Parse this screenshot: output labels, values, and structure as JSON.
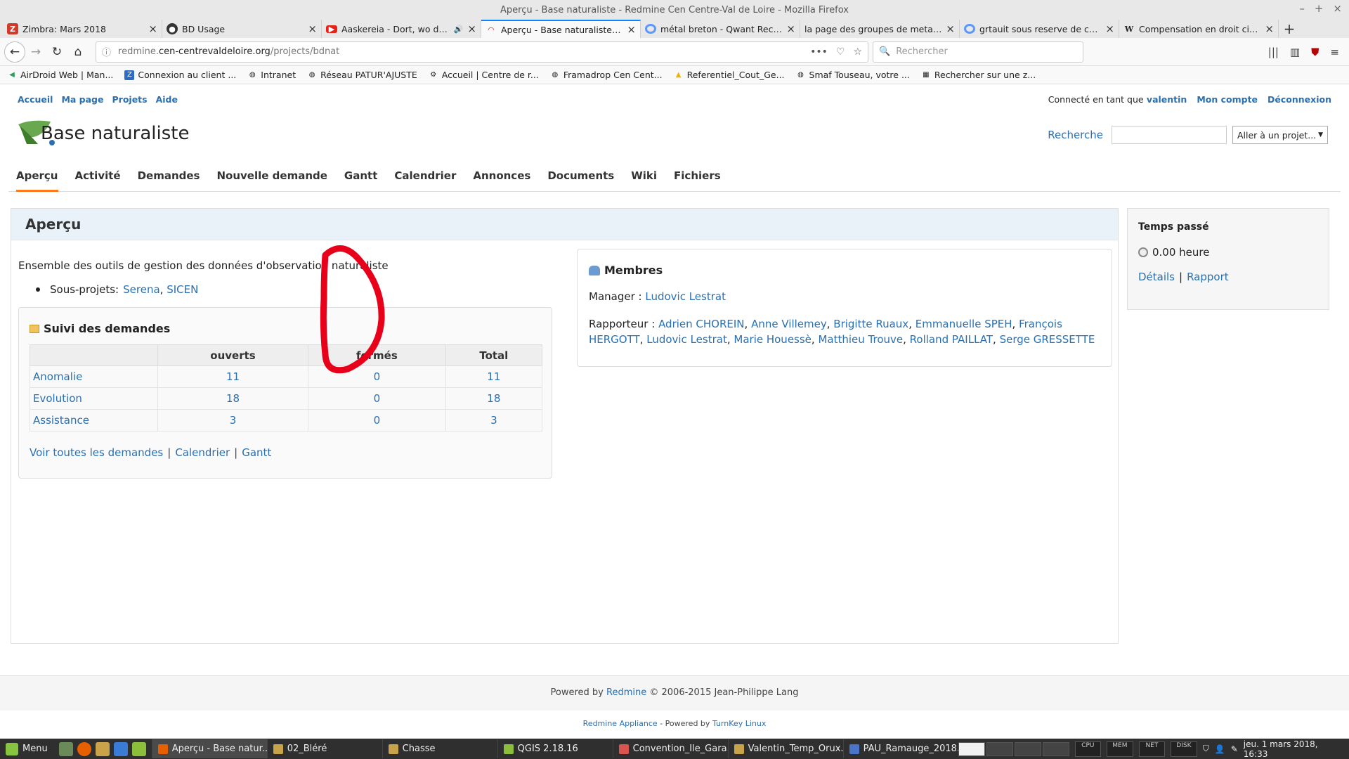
{
  "window": {
    "title": "Aperçu - Base naturaliste - Redmine Cen Centre-Val de Loire - Mozilla Firefox"
  },
  "tabs": [
    {
      "label": "Zimbra: Mars 2018",
      "icon": "zimbra-icon",
      "color": "#d03a2b"
    },
    {
      "label": "BD Usage",
      "icon": "app-icon",
      "color": "#333333"
    },
    {
      "label": "Aaskereia - Dort, wo das alt",
      "icon": "youtube-icon",
      "color": "#e62117"
    },
    {
      "label": "Aperçu - Base naturaliste - Redm",
      "icon": "redmine-icon",
      "color": "#b32024"
    },
    {
      "label": "métal breton - Qwant Recherche",
      "icon": "qwant-icon",
      "color": "#5c97ff"
    },
    {
      "label": "la page des groupes de metal bret",
      "icon": "blank-icon",
      "color": "#999999"
    },
    {
      "label": "grtauit sous reserve de comp",
      "icon": "qwant-icon",
      "color": "#5c97ff"
    },
    {
      "label": "Compensation en droit civil fr",
      "icon": "wikipedia-icon",
      "color": "#222222"
    }
  ],
  "urlbar": {
    "domain_prefix": "redmine.",
    "domain": "cen-centrevaldeloire.org",
    "path": "/projects/bdnat",
    "dots": "•••"
  },
  "searchbar": {
    "placeholder": "Rechercher"
  },
  "bookmarks": [
    {
      "label": "AirDroid Web | Man...",
      "color": "#2e9d5b"
    },
    {
      "label": "Connexion au client ...",
      "color": "#2b6cc4"
    },
    {
      "label": "Intranet",
      "color": "#666666"
    },
    {
      "label": "Réseau PATUR'AJUSTE",
      "color": "#666666"
    },
    {
      "label": "Accueil | Centre de r...",
      "color": "#666666"
    },
    {
      "label": "Framadrop Cen Cent...",
      "color": "#666666"
    },
    {
      "label": "Referentiel_Cout_Ge...",
      "color": "#f0b400"
    },
    {
      "label": "Smaf Touseau, votre ...",
      "color": "#666666"
    },
    {
      "label": "Rechercher sur une z...",
      "color": "#666666"
    }
  ],
  "topmenu": {
    "left": [
      "Accueil",
      "Ma page",
      "Projets",
      "Aide"
    ],
    "logged_as": "Connecté en tant que",
    "user": "valentin",
    "account": "Mon compte",
    "logout": "Déconnexion"
  },
  "header": {
    "project_title": "Base naturaliste",
    "search_label": "Recherche",
    "jump_label": "Aller à un projet..."
  },
  "mainmenu": [
    "Aperçu",
    "Activité",
    "Demandes",
    "Nouvelle demande",
    "Gantt",
    "Calendrier",
    "Annonces",
    "Documents",
    "Wiki",
    "Fichiers"
  ],
  "content": {
    "title": "Aperçu",
    "description": "Ensemble des outils de gestion des données d'observation naturaliste",
    "subprojects_label": "Sous-projets:",
    "subprojects": [
      "Serena",
      "SICEN"
    ],
    "issues": {
      "title": "Suivi des demandes",
      "headers": [
        "",
        "ouverts",
        "fermés",
        "Total"
      ],
      "rows": [
        {
          "tracker": "Anomalie",
          "open": "11",
          "closed": "0",
          "total": "11"
        },
        {
          "tracker": "Evolution",
          "open": "18",
          "closed": "0",
          "total": "18"
        },
        {
          "tracker": "Assistance",
          "open": "3",
          "closed": "0",
          "total": "3"
        }
      ],
      "links": [
        "Voir toutes les demandes",
        "Calendrier",
        "Gantt"
      ]
    },
    "members": {
      "title": "Membres",
      "manager_label": "Manager :",
      "manager": "Ludovic Lestrat",
      "reporter_label": "Rapporteur :",
      "reporters": [
        "Adrien CHOREIN",
        "Anne Villemey",
        "Brigitte Ruaux",
        "Emmanuelle SPEH",
        "François HERGOTT",
        "Ludovic Lestrat",
        "Marie Houessè",
        "Matthieu Trouve",
        "Rolland PAILLAT",
        "Serge GRESSETTE"
      ]
    }
  },
  "sidebar": {
    "title": "Temps passé",
    "hours": "0.00 heure",
    "details": "Détails",
    "report": "Rapport"
  },
  "footer": {
    "powered_by": "Powered by",
    "redmine": "Redmine",
    "copyright": "© 2006-2015 Jean-Philippe Lang",
    "appliance": "Redmine Appliance",
    "powered_by2": "- Powered by",
    "turnkey": "TurnKey Linux"
  },
  "taskbar": {
    "menu": "Menu",
    "tasks": [
      {
        "label": "Aperçu - Base natur...",
        "color": "#e66000"
      },
      {
        "label": "02_Bléré",
        "color": "#c8a34a"
      },
      {
        "label": "Chasse",
        "color": "#c8a34a"
      },
      {
        "label": "QGIS 2.18.16",
        "color": "#8cbe3c"
      },
      {
        "label": "Convention_Ile_Gara...",
        "color": "#d9534f"
      },
      {
        "label": "Valentin_Temp_Orux...",
        "color": "#c8a34a"
      },
      {
        "label": "PAU_Ramauge_2018...",
        "color": "#4a74c9"
      }
    ],
    "monitors": [
      "CPU",
      "MEM",
      "NET",
      "DISK"
    ],
    "clock": "jeu. 1 mars 2018, 16:33"
  },
  "annotation": {
    "color": "#e8001a"
  }
}
